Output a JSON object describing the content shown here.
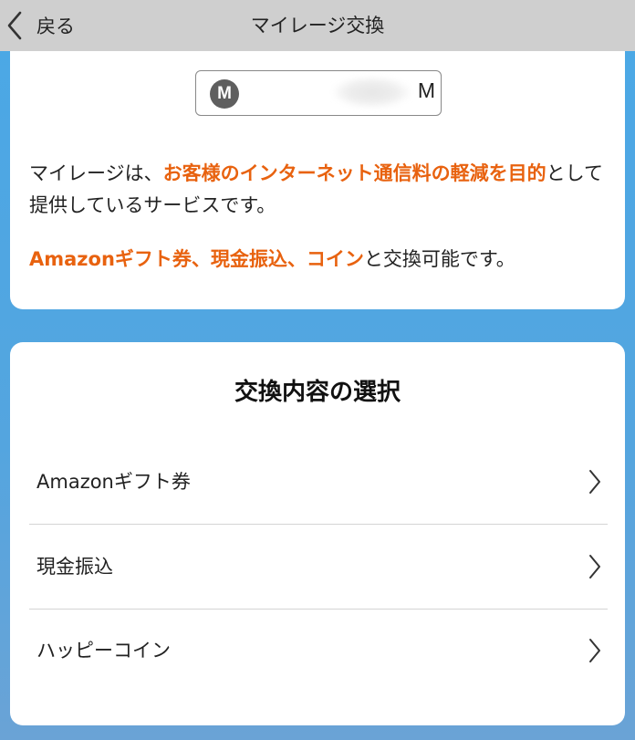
{
  "header": {
    "back_label": "戻る",
    "title": "マイレージ交換",
    "back_icon": "chevron-left-icon"
  },
  "miles": {
    "badge": "M",
    "unit": "M"
  },
  "intro": {
    "prefix": "マイレージは、",
    "highlight": "お客様のインターネット通信料の軽減を目的",
    "suffix": "として提供しているサービスです。"
  },
  "exchange_note": {
    "highlight": "Amazonギフト券、現金振込、コイン",
    "suffix": "と交換可能です。"
  },
  "selection": {
    "title": "交換内容の選択",
    "options": [
      {
        "label": "Amazonギフト券",
        "icon": "chevron-right-icon"
      },
      {
        "label": "現金振込",
        "icon": "chevron-right-icon"
      },
      {
        "label": "ハッピーコイン",
        "icon": "chevron-right-icon"
      }
    ]
  },
  "colors": {
    "highlight": "#e8620f",
    "header_bg": "#cfcfcf",
    "page_bg": "#4aa8e6",
    "badge_bg": "#5f5f5f"
  }
}
